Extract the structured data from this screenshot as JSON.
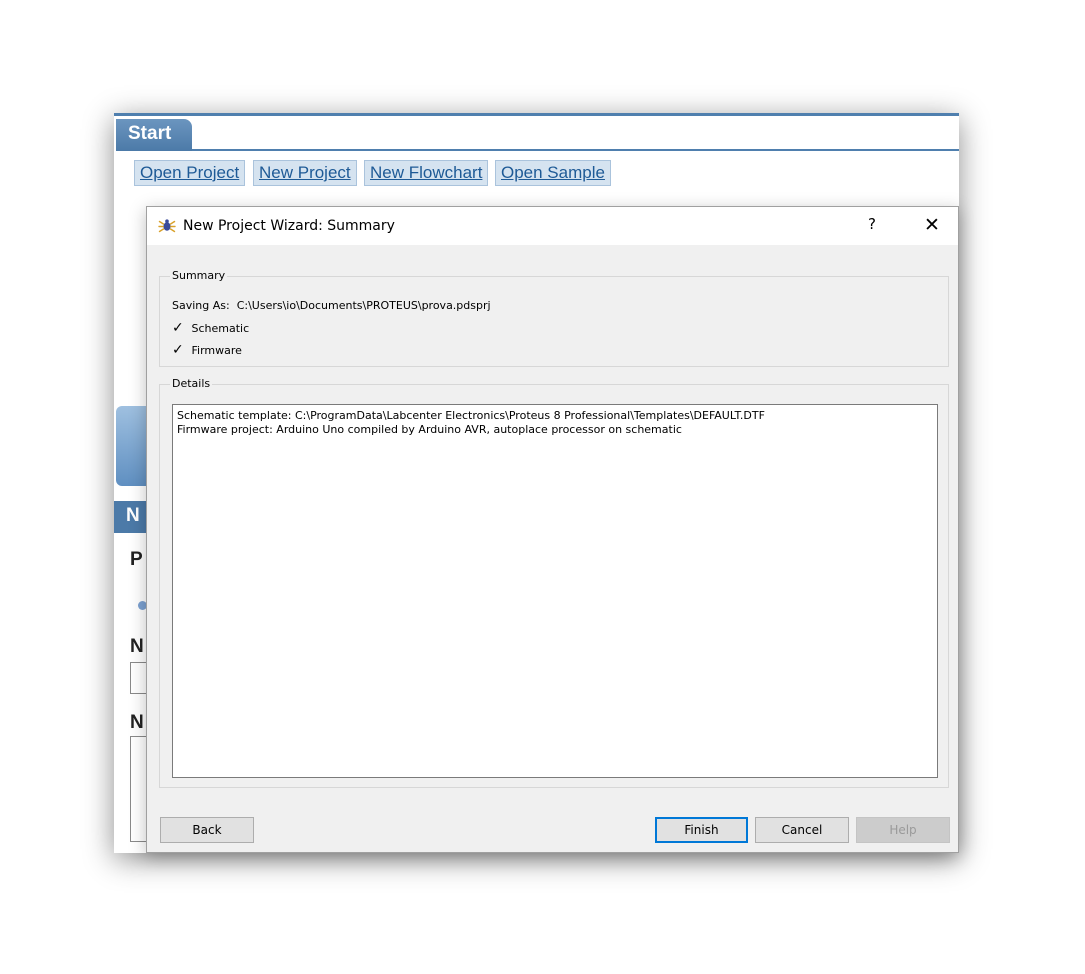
{
  "start_page": {
    "tab_label": "Start",
    "links": [
      "Open Project",
      "New Project",
      "New Flowchart",
      "Open Sample"
    ],
    "fragments": {
      "new_header": "N",
      "p_heading": "P",
      "n_label_1": "N",
      "n_label_2": "N"
    }
  },
  "dialog": {
    "title": "New Project Wizard: Summary",
    "help_glyph": "?",
    "close_glyph": "✕",
    "summary": {
      "legend": "Summary",
      "saving_as_label": "Saving As:",
      "saving_as_path": "C:\\Users\\io\\Documents\\PROTEUS\\prova.pdsprj",
      "checked_items": [
        "Schematic",
        "Firmware"
      ]
    },
    "details": {
      "legend": "Details",
      "lines": [
        "Schematic template: C:\\ProgramData\\Labcenter Electronics\\Proteus 8 Professional\\Templates\\DEFAULT.DTF",
        "Firmware project: Arduino Uno compiled by Arduino AVR, autoplace processor on schematic"
      ]
    },
    "buttons": {
      "back": "Back",
      "finish": "Finish",
      "cancel": "Cancel",
      "help": "Help"
    }
  },
  "colors": {
    "start_blue": "#4f7fae",
    "link_text": "#1e5a96",
    "default_button_border": "#0078d7"
  }
}
